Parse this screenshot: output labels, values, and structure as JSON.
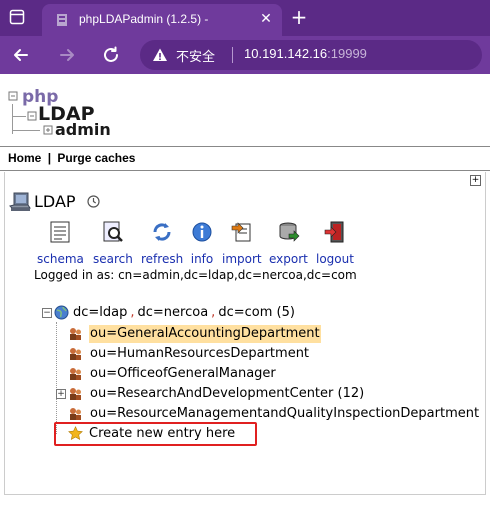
{
  "browser": {
    "tab_title": "phpLDAPadmin (1.2.5) -",
    "security_label": "不安全",
    "url_host": "10.191.142.16",
    "url_port": ":19999",
    "theme_color": "#6f3a9c"
  },
  "header": {
    "logo_alt": "phpLDAPadmin"
  },
  "menu": {
    "home": "Home",
    "separator": "|",
    "purge": "Purge caches"
  },
  "server": {
    "name": "LDAP",
    "actions": [
      {
        "label": "schema",
        "icon": "schema-icon"
      },
      {
        "label": "search",
        "icon": "search-icon"
      },
      {
        "label": "refresh",
        "icon": "refresh-icon"
      },
      {
        "label": "info",
        "icon": "info-icon"
      },
      {
        "label": "import",
        "icon": "import-icon"
      },
      {
        "label": "export",
        "icon": "export-icon"
      },
      {
        "label": "logout",
        "icon": "logout-icon"
      }
    ],
    "logged_in_as": "Logged in as: cn=admin,dc=ldap,dc=nercoa,dc=com"
  },
  "tree": {
    "root": {
      "dn_parts": [
        "dc=ldap",
        ",",
        "dc=nercoa",
        ",",
        "dc=com"
      ],
      "count": "(5)"
    },
    "children": [
      {
        "label": "ou=GeneralAccountingDepartment",
        "selected": true
      },
      {
        "label": "ou=HumanResourcesDepartment"
      },
      {
        "label": "ou=OfficeofGeneralManager"
      },
      {
        "label": "ou=ResearchAndDevelopmentCenter",
        "count": "(12)"
      },
      {
        "label": "ou=ResourceManagementandQualityInspectionDepartment"
      }
    ],
    "create_entry": "Create new entry here"
  }
}
